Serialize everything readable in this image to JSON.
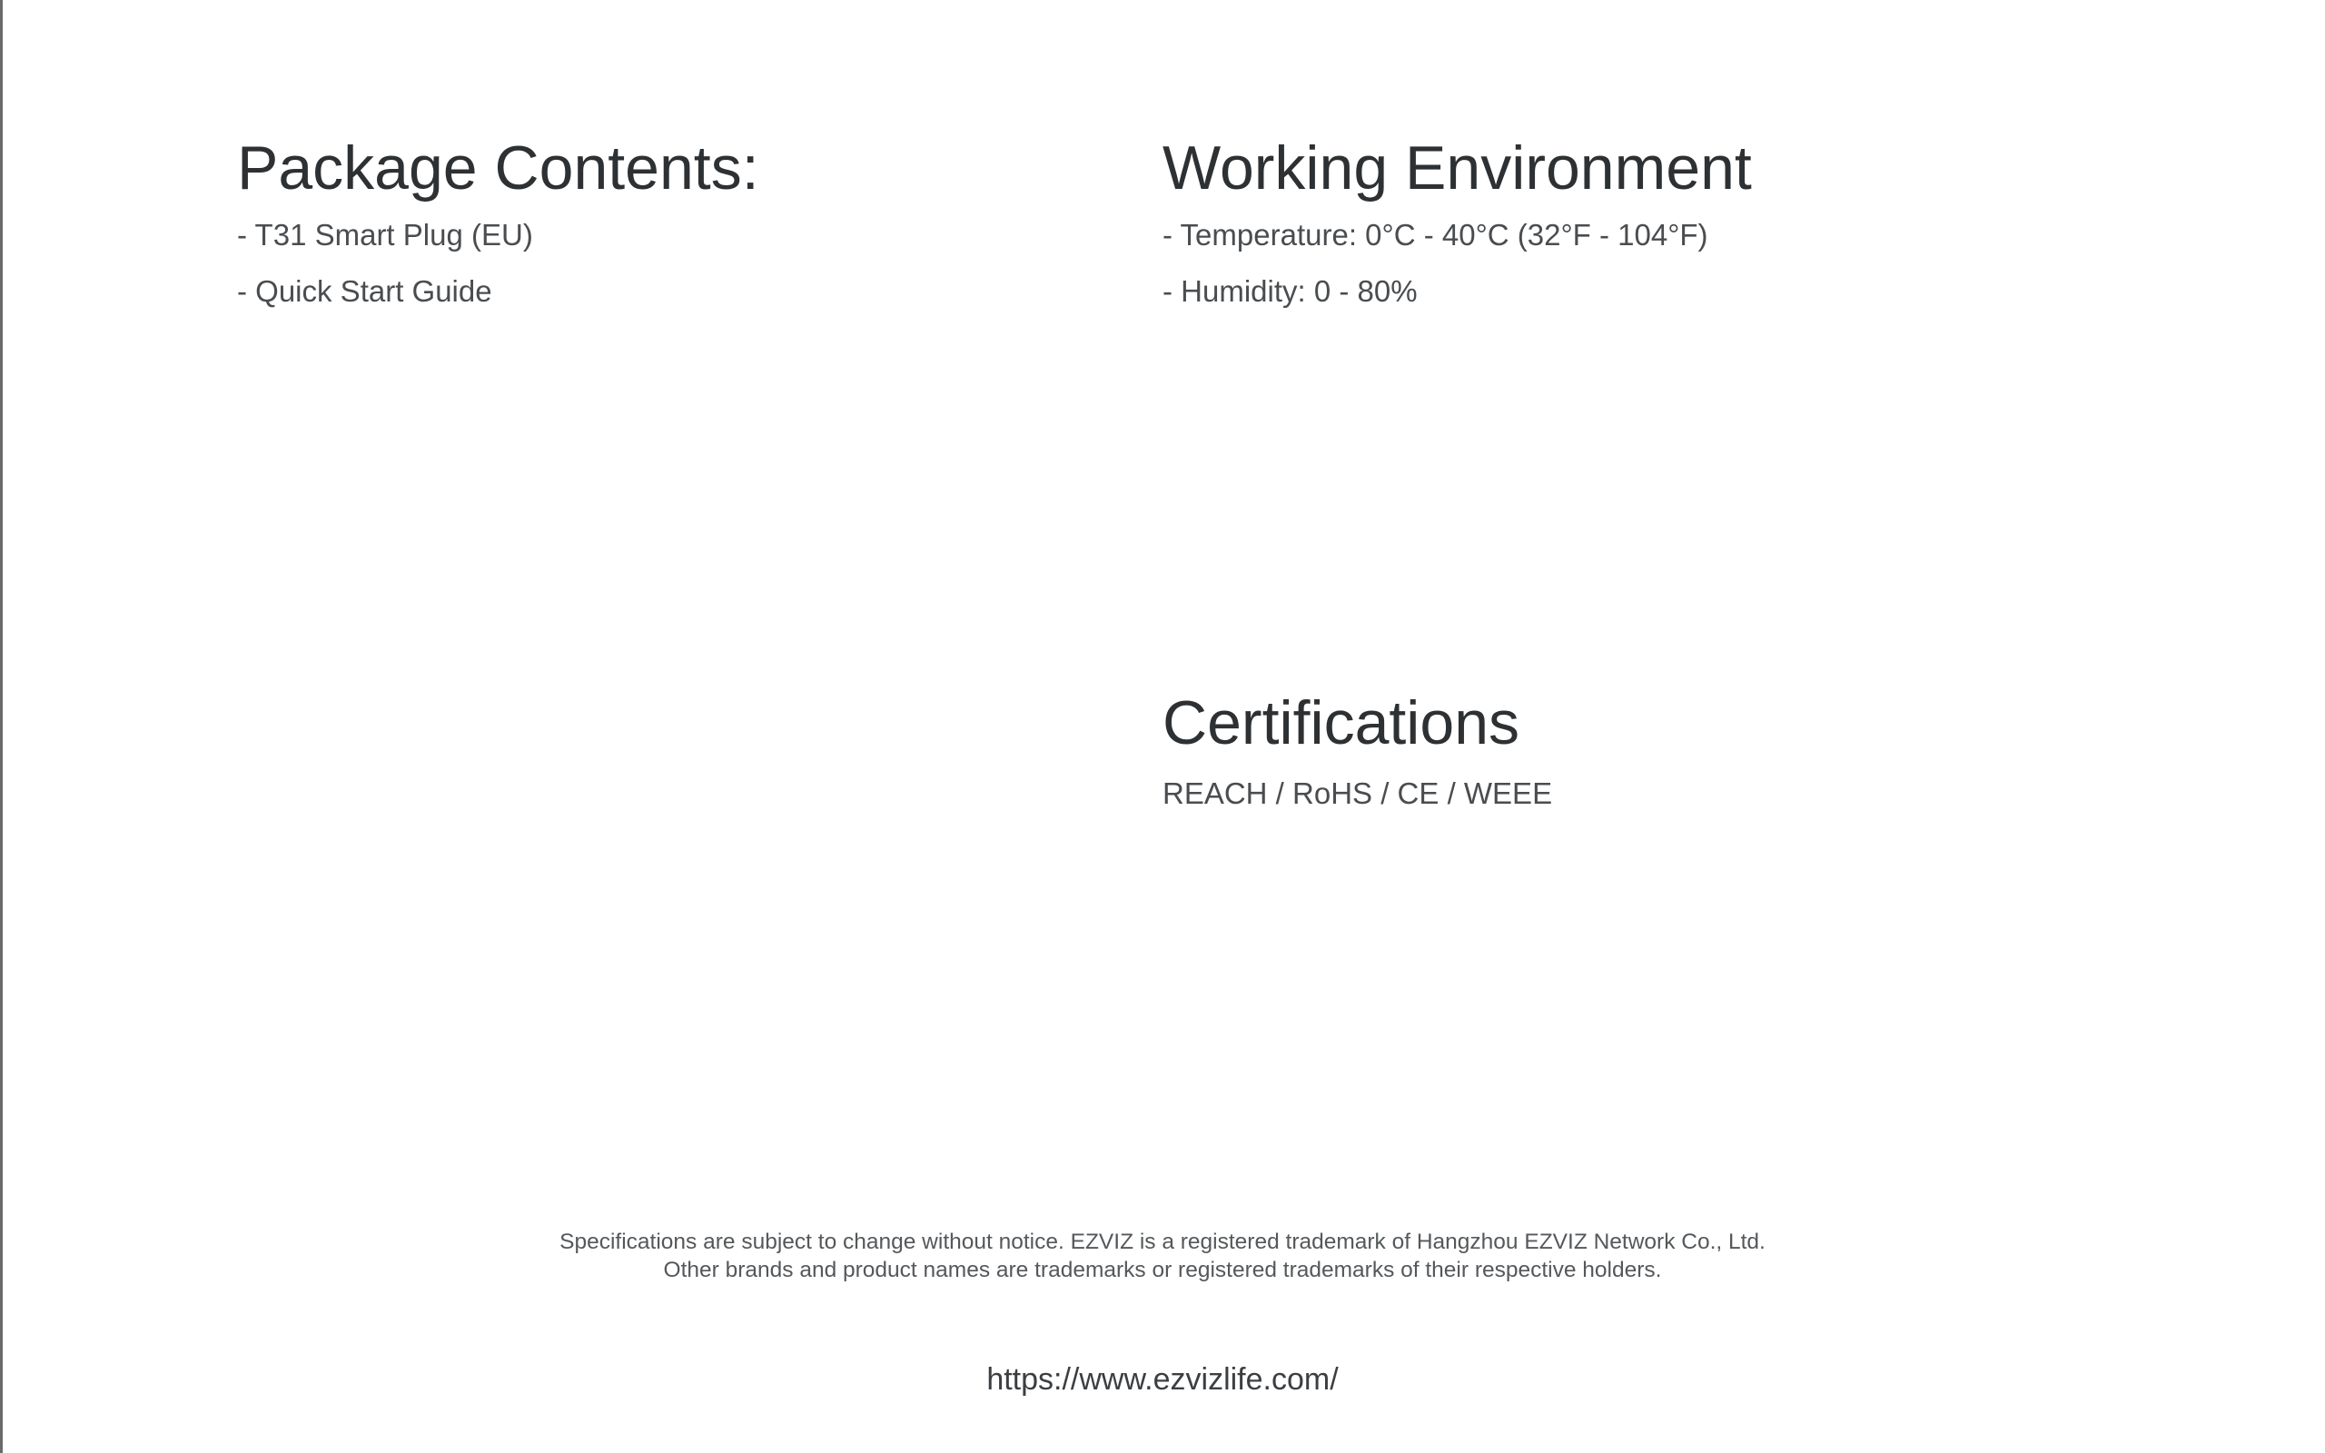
{
  "package": {
    "title": "Package Contents:",
    "items": [
      "- T31 Smart Plug (EU)",
      "- Quick Start Guide"
    ]
  },
  "environment": {
    "title": "Working Environment",
    "items": [
      "- Temperature: 0°C - 40°C (32°F - 104°F)",
      "- Humidity: 0 - 80%"
    ]
  },
  "certifications": {
    "title": "Certifications",
    "text": "REACH / RoHS / CE / WEEE"
  },
  "footer": {
    "line1": "Specifications are subject to change without notice. EZVIZ is a registered trademark of Hangzhou EZVIZ Network Co., Ltd.",
    "line2": "Other brands and product names are trademarks or registered trademarks of their respective holders.",
    "website": "https://www.ezvizlife.com/"
  }
}
